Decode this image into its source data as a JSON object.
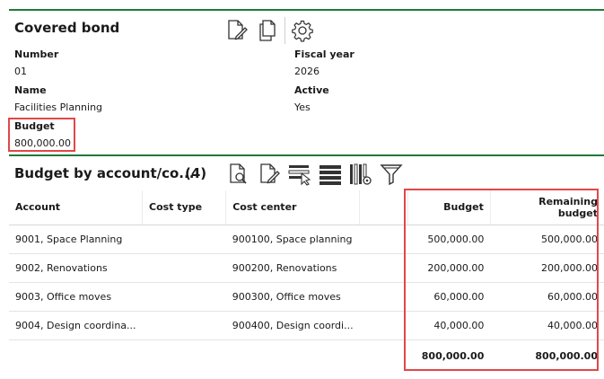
{
  "header": {
    "title": "Covered bond"
  },
  "toolbar": {
    "icons": [
      "edit-document-icon",
      "copy-icon",
      "settings-gear-icon"
    ]
  },
  "fields": {
    "number_label": "Number",
    "number_value": "01",
    "fiscal_year_label": "Fiscal year",
    "fiscal_year_value": "2026",
    "name_label": "Name",
    "name_value": "Facilities Planning",
    "active_label": "Active",
    "active_value": "Yes",
    "budget_label": "Budget",
    "budget_value": "800,000.00"
  },
  "section": {
    "title": "Budget by account/co...",
    "count": "(4)",
    "icons": [
      "search-document-icon",
      "edit-document-icon",
      "filter-row-icon",
      "list-lines-icon",
      "column-settings-icon",
      "funnel-filter-icon"
    ]
  },
  "table": {
    "columns": [
      "Account",
      "Cost type",
      "Cost center",
      "",
      "Budget",
      "Remaining budget"
    ],
    "rows": [
      {
        "account": "9001, Space Planning",
        "cost_type": "",
        "cost_center": "900100, Space planning",
        "budget": "500,000.00",
        "remaining": "500,000.00"
      },
      {
        "account": "9002, Renovations",
        "cost_type": "",
        "cost_center": "900200, Renovations",
        "budget": "200,000.00",
        "remaining": "200,000.00"
      },
      {
        "account": "9003, Office moves",
        "cost_type": "",
        "cost_center": "900300, Office moves",
        "budget": "60,000.00",
        "remaining": "60,000.00"
      },
      {
        "account": "9004, Design coordina...",
        "cost_type": "",
        "cost_center": "900400, Design coordi...",
        "budget": "40,000.00",
        "remaining": "40,000.00"
      }
    ],
    "totals": {
      "budget": "800,000.00",
      "remaining": "800,000.00"
    }
  },
  "colors": {
    "accent_rule": "#1f7a3a",
    "highlight": "#e04848"
  }
}
